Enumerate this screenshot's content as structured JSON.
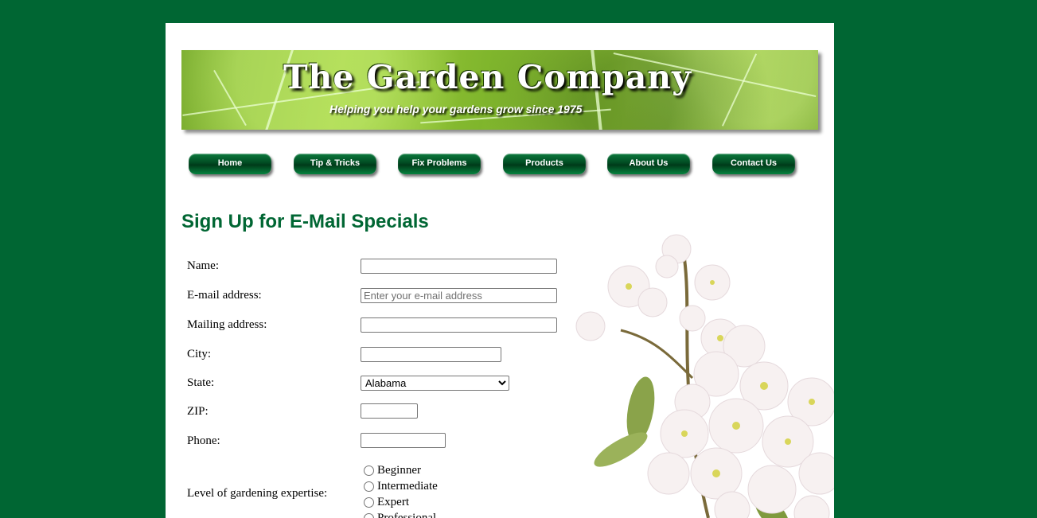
{
  "banner": {
    "title": "The Garden Company",
    "tagline": "Helping you help your gardens grow since 1975"
  },
  "nav": {
    "items": [
      {
        "label": "Home"
      },
      {
        "label": "Tip & Tricks"
      },
      {
        "label": "Fix Problems"
      },
      {
        "label": "Products"
      },
      {
        "label": "About Us"
      },
      {
        "label": "Contact Us"
      }
    ]
  },
  "page": {
    "heading": "Sign Up for E-Mail Specials"
  },
  "form": {
    "name_label": "Name:",
    "name_value": "",
    "email_label": "E-mail address:",
    "email_placeholder": "Enter your e-mail address",
    "mailing_label": "Mailing address:",
    "mailing_value": "",
    "city_label": "City:",
    "city_value": "",
    "state_label": "State:",
    "state_selected": "Alabama",
    "zip_label": "ZIP:",
    "zip_value": "",
    "phone_label": "Phone:",
    "phone_value": "",
    "expertise_label": "Level of gardening expertise:",
    "expertise_options": [
      "Beginner",
      "Intermediate",
      "Expert",
      "Professional"
    ]
  },
  "colors": {
    "background": "#006633",
    "heading": "#006633",
    "nav_button": "#014b22"
  }
}
